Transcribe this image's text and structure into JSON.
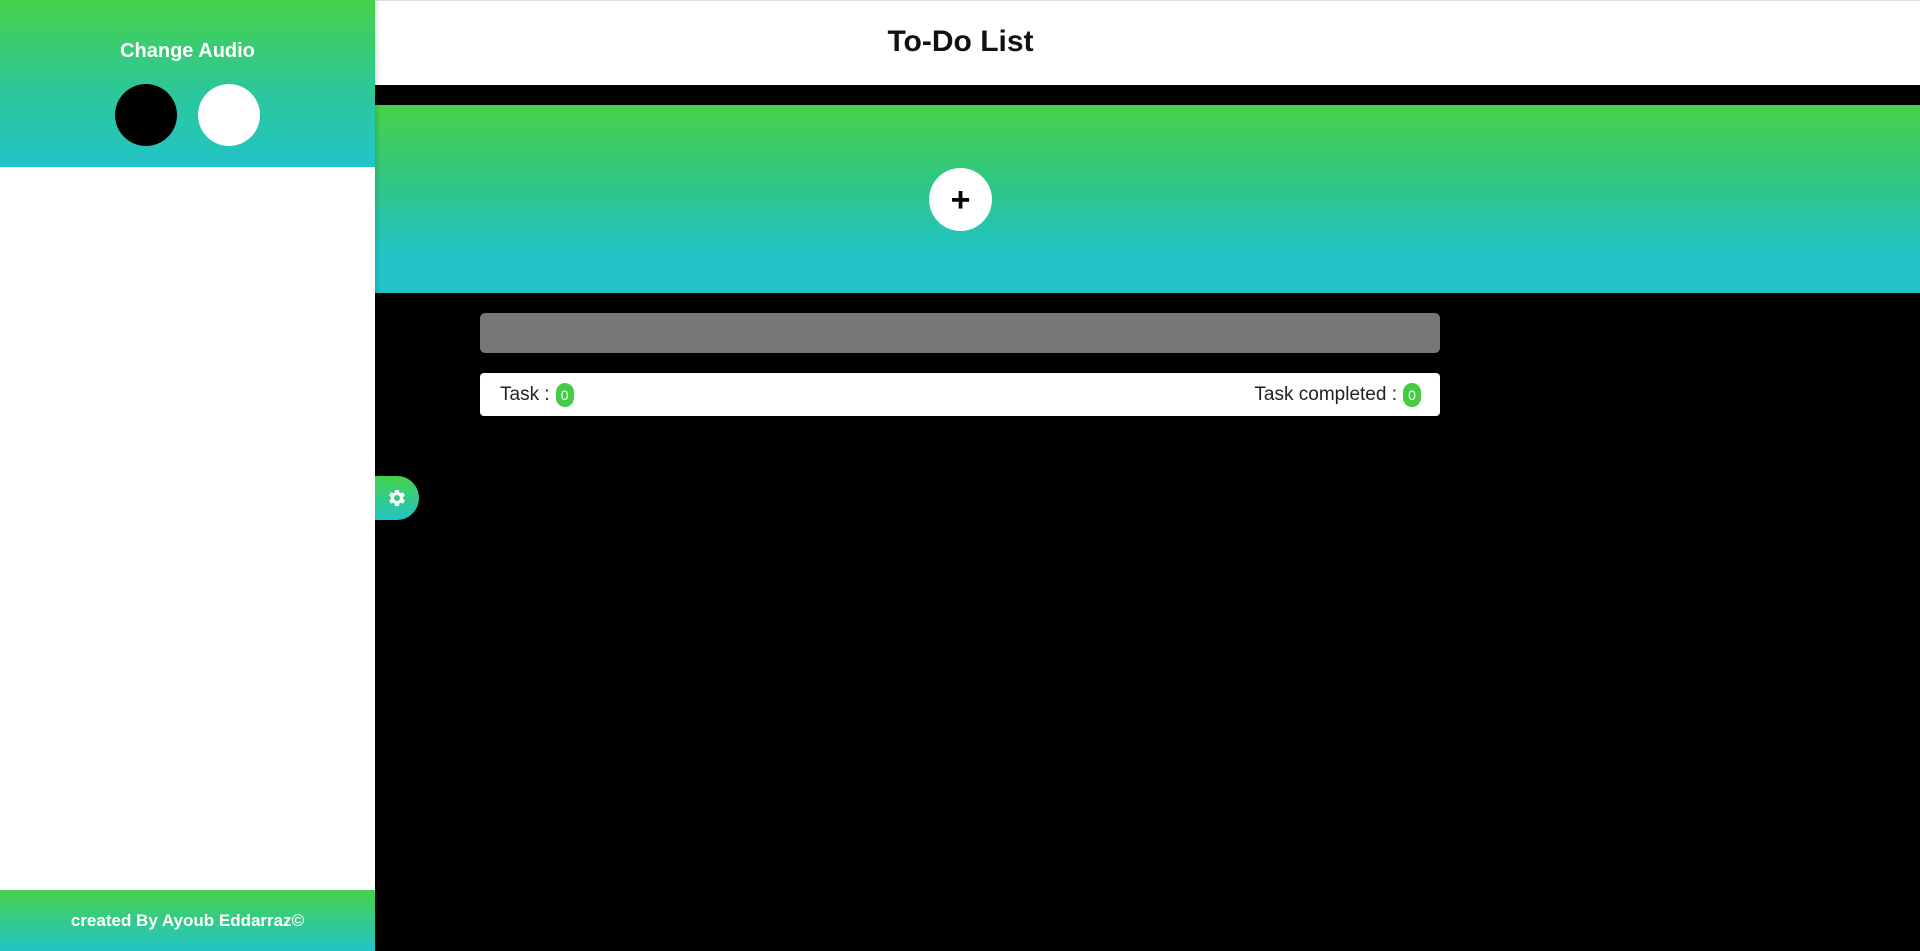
{
  "sidebar": {
    "title": "Change Audio",
    "audio_options": [
      {
        "name": "black",
        "color": "#000000"
      },
      {
        "name": "white",
        "color": "#ffffff"
      }
    ],
    "footer_text": "created By Ayoub Eddarraz©"
  },
  "header": {
    "title": "To-Do List"
  },
  "hero": {
    "add_label": "+",
    "gradient_top": "#47d14b",
    "gradient_bottom": "#22c4c8"
  },
  "task_input": {
    "value": "",
    "placeholder": ""
  },
  "stats": {
    "task_label": "Task :",
    "task_count": "0",
    "completed_label": "Task completed :",
    "completed_count": "0"
  },
  "settings": {
    "icon": "gear-icon"
  }
}
